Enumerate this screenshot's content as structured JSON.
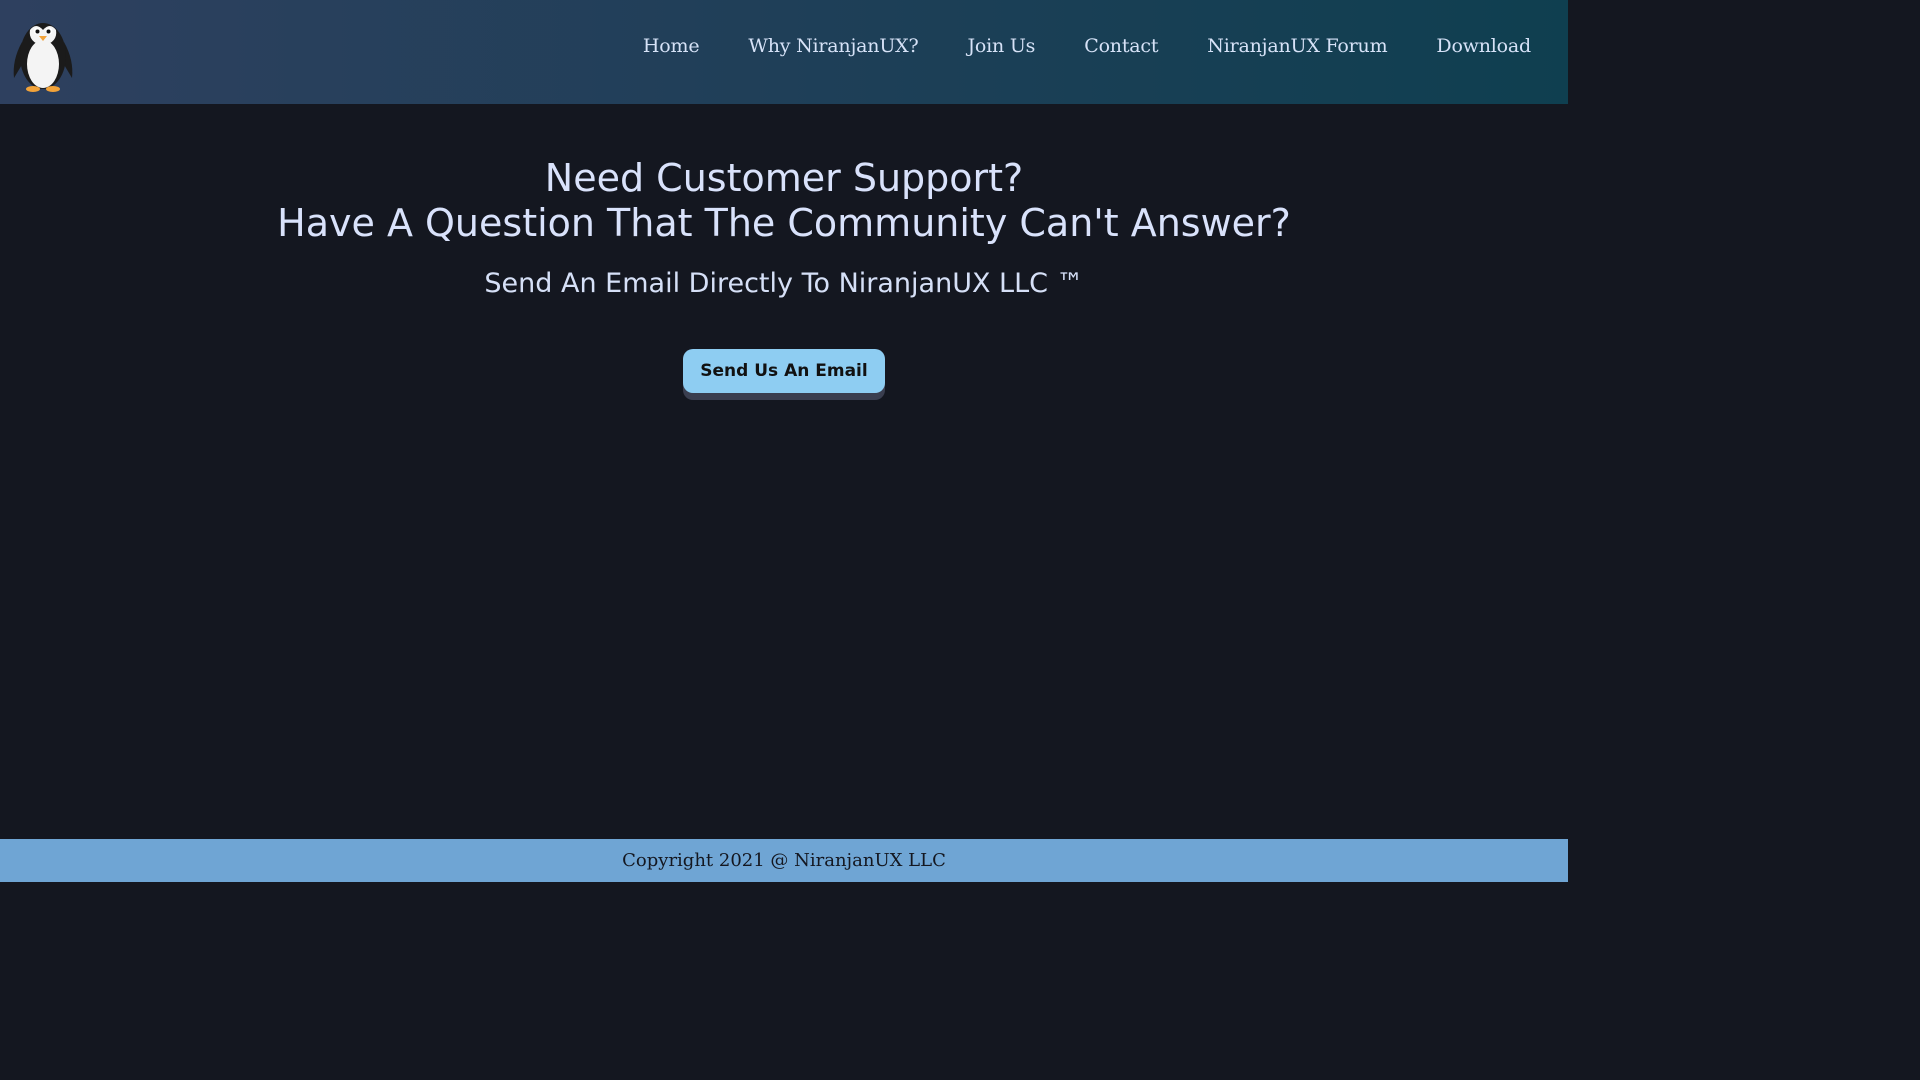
{
  "brand": {
    "logo_icon": "penguin-icon"
  },
  "nav": {
    "items": [
      {
        "label": "Home"
      },
      {
        "label": "Why NiranjanUX?"
      },
      {
        "label": "Join Us"
      },
      {
        "label": "Contact"
      },
      {
        "label": "NiranjanUX Forum"
      },
      {
        "label": "Download"
      }
    ]
  },
  "main": {
    "headline_line1": "Need Customer Support?",
    "headline_line2": "Have A Question That The Community Can't Answer?",
    "subheadline": "Send An Email Directly To NiranjanUX LLC ™",
    "cta_label": "Send Us An Email"
  },
  "footer": {
    "copyright": "Copyright 2021 @ NiranjanUX LLC"
  },
  "colors": {
    "header_gradient_start": "#2e405f",
    "header_gradient_end": "#0f3f50",
    "page_background": "#141720",
    "heading_text": "#d9e2fb",
    "button_background": "#8ecdf2",
    "footer_background": "#6fa5d4"
  }
}
